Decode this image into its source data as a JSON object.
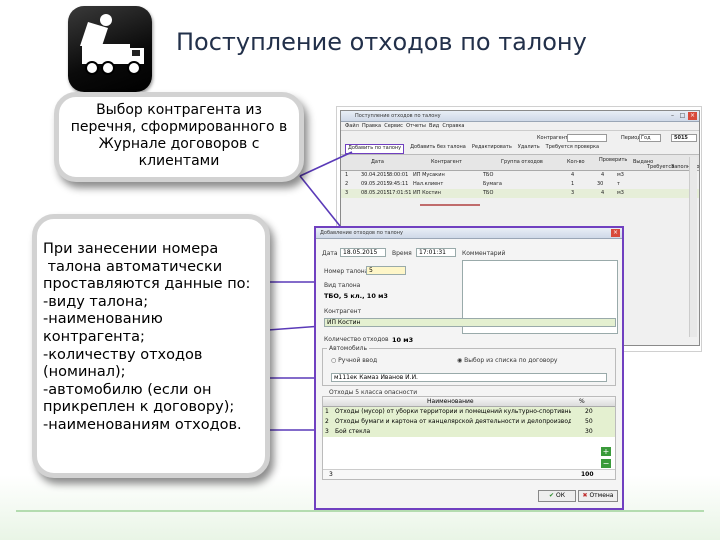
{
  "slide": {
    "title": "Поступление отходов по талону",
    "callout1": "Выбор контрагента из\nперечня, сформированного в\nЖурнале договоров с\nклиентами",
    "callout2": "При занесении номера\n талона автоматически\nпроставляются данные по:\n-виду талона;\n-наименованию\nконтрагента;\n-количеству отходов\n(номинал);\n-автомобилю (если он\nприкреплен к договору);\n-наименованиям отходов."
  },
  "back_window": {
    "title": "Поступление отходов по талону",
    "menu": [
      "Файл",
      "Правка",
      "Сервис",
      "Отчеты",
      "Вид",
      "Справка"
    ],
    "toolbar": [
      "Добавить по талону",
      "Добавить без талона",
      "Редактировать",
      "Удалить",
      "Требуется проверка"
    ],
    "filter_label": "Контрагент",
    "period_label": "Период",
    "year": "Год",
    "code": "5015",
    "col_headers": [
      "Дата",
      "Контрагент",
      "Группа отходов",
      "Кол-во",
      "Проверить",
      "Выдано",
      "Требуется",
      "Заполнено"
    ],
    "rows": [
      {
        "n": "1",
        "date": "30.04.2015",
        "time": "8:00:01",
        "name": "ИП Мусакин",
        "grp": "ТБО",
        "qty": "4",
        "a": "4",
        "b": "м3"
      },
      {
        "n": "2",
        "date": "09.05.2015",
        "time": "9:45:11",
        "name": "Нал.клиент",
        "grp": "Бумага",
        "qty": "1",
        "a": "30",
        "b": "т"
      },
      {
        "n": "3",
        "date": "08.05.2015",
        "time": "17:01:51",
        "name": "ИП Костин",
        "grp": "ТБО",
        "qty": "3",
        "a": "4",
        "b": "м3"
      }
    ]
  },
  "front_window": {
    "title": "Добавление отходов по талону",
    "date_label": "Дата",
    "date_value": "18.05.2015",
    "time_label": "Время",
    "time_value": "17:01:31",
    "comment_label": "Комментарий",
    "ticket_no_label": "Номер талона",
    "ticket_no_value": "5",
    "ticket_type_label": "Вид талона",
    "ticket_type_value": "ТБО, 5 кл., 10 м3",
    "contractor_label": "Контрагент",
    "contractor_value": "ИП Костин",
    "quantity_label": "Количество отходов",
    "quantity_value": "10 м3",
    "vehicle_group": "Автомобиль",
    "radio_manual": "Ручной ввод",
    "radio_list": "Выбор из списка по договору",
    "vehicle_value": "м111ек Камаз Иванов И.И.",
    "waste_group": "Отходы 5 класса опасности",
    "waste_header_name": "Наименование",
    "waste_header_pct": "%",
    "waste_rows": [
      {
        "n": "1",
        "name": "Отходы (мусор) от уборки территории и помещений культурно-спортивных",
        "pct": "20"
      },
      {
        "n": "2",
        "name": "Отходы бумаги и картона от канцелярской деятельности и делопроизводства",
        "pct": "50"
      },
      {
        "n": "3",
        "name": "Бой стекла",
        "pct": "30"
      }
    ],
    "footer_count": "3",
    "footer_total": "100",
    "ok_label": "ОК",
    "cancel_label": "Отмена"
  },
  "colors": {
    "callout_border": "#d2d2d2",
    "connector": "#5a3ab8",
    "front_window_border": "#7040c0",
    "title": "#22304a"
  }
}
